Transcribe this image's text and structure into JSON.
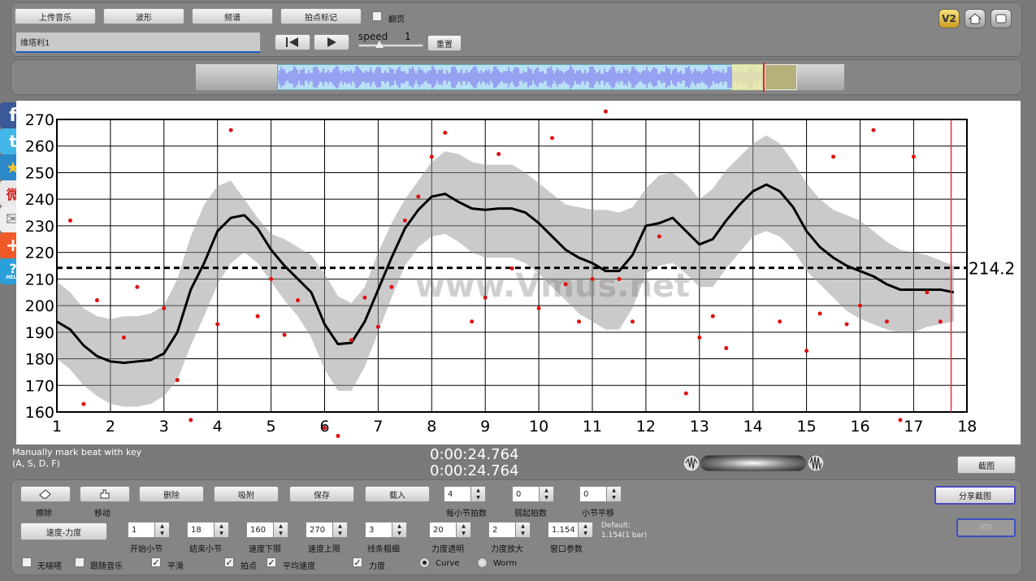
{
  "toolbar": {
    "upload_label": "上传音乐",
    "waveform_label": "波形",
    "spectrum_label": "频谱",
    "mark_beat_label": "拍点标记",
    "flip_label": "翻页",
    "track_title": "维塔利1",
    "speed_label": "speed",
    "speed_value": "1",
    "reset_label": "重置",
    "v2_label": "V2"
  },
  "social": [
    "f",
    "t",
    "★",
    "微",
    "✉",
    "+",
    "?"
  ],
  "social_help_text": "HELP",
  "chart_data": {
    "type": "line",
    "title": "",
    "xlabel": "",
    "ylabel": "",
    "xlim": [
      1,
      18
    ],
    "ylim": [
      160,
      270
    ],
    "xticks": [
      "1",
      "2",
      "3",
      "4",
      "5",
      "6",
      "7",
      "8",
      "9",
      "10",
      "11",
      "12",
      "13",
      "14",
      "15",
      "16",
      "17",
      "18"
    ],
    "yticks": [
      "160",
      "170",
      "180",
      "190",
      "200",
      "210",
      "220",
      "230",
      "240",
      "250",
      "260",
      "270"
    ],
    "average": 214.2,
    "average_label": "214.2",
    "end_marker_x": 17.7,
    "watermark": "www.Vmus.net",
    "smooth_curve": {
      "x": [
        1,
        1.25,
        1.5,
        1.75,
        2,
        2.25,
        2.5,
        2.75,
        3,
        3.25,
        3.5,
        3.75,
        4,
        4.25,
        4.5,
        4.75,
        5,
        5.25,
        5.5,
        5.75,
        6,
        6.25,
        6.5,
        6.75,
        7,
        7.25,
        7.5,
        7.75,
        8,
        8.25,
        8.5,
        8.75,
        9,
        9.25,
        9.5,
        9.75,
        10,
        10.25,
        10.5,
        10.75,
        11,
        11.25,
        11.5,
        11.75,
        12,
        12.25,
        12.5,
        12.75,
        13,
        13.25,
        13.5,
        13.75,
        14,
        14.25,
        14.5,
        14.75,
        15,
        15.25,
        15.5,
        15.75,
        16,
        16.25,
        16.5,
        16.75,
        17,
        17.25,
        17.5,
        17.75
      ],
      "y": [
        194,
        191,
        185,
        181,
        179,
        178.5,
        179,
        179.5,
        182,
        190,
        206,
        216,
        228,
        233,
        234,
        229,
        221,
        215,
        210,
        205,
        193,
        185.5,
        186,
        194,
        206,
        218,
        229,
        236,
        241,
        242,
        239,
        236.5,
        236,
        236.5,
        236.5,
        235,
        231,
        226,
        221,
        218,
        216,
        213,
        213,
        219,
        230,
        231,
        233,
        228,
        223,
        225,
        232,
        238,
        243,
        245.5,
        243,
        237,
        228,
        222,
        218,
        215,
        213,
        211,
        208,
        206,
        206,
        206,
        206,
        205
      ]
    },
    "band_upper": [
      209,
      205,
      199,
      196,
      195,
      196,
      196,
      197,
      200,
      210,
      226,
      238,
      245,
      247,
      240,
      233,
      227,
      225,
      222,
      219,
      212,
      203.5,
      201,
      207,
      220,
      231,
      240,
      247,
      254,
      258,
      257,
      254,
      253,
      253,
      253,
      250,
      246,
      242,
      238,
      237,
      236,
      236,
      235,
      237,
      244,
      249,
      250,
      246,
      240,
      244,
      251,
      256,
      261,
      264,
      261,
      254,
      246,
      240,
      236,
      234,
      232,
      228,
      224,
      221,
      220,
      219,
      217,
      215
    ],
    "band_lower": [
      180,
      176,
      170,
      166,
      163,
      162,
      162,
      163,
      166,
      172,
      185,
      196,
      208,
      216,
      220,
      216,
      209,
      202,
      196,
      188,
      176,
      168,
      168,
      177,
      190,
      203,
      215,
      222,
      226,
      227,
      224,
      220,
      218,
      218,
      218,
      216,
      212,
      207,
      202,
      197,
      194,
      191,
      191,
      199,
      212,
      215,
      216,
      212,
      207,
      207,
      214,
      220,
      226,
      228,
      226,
      221,
      213,
      208,
      203,
      198,
      195,
      193,
      191,
      190,
      190,
      192,
      193,
      194
    ],
    "scatter": {
      "x": [
        1.25,
        1.5,
        1.75,
        2.25,
        2.5,
        3,
        3.25,
        3.5,
        4,
        4.25,
        4.75,
        5,
        5.25,
        5.5,
        6,
        6.25,
        6.5,
        6.75,
        7,
        7.25,
        7.5,
        7.75,
        8,
        8.25,
        8.75,
        9,
        9.25,
        9.5,
        10,
        10.25,
        10.5,
        10.75,
        11,
        11.25,
        11.5,
        11.75,
        12.25,
        12.75,
        13,
        13.25,
        13.5,
        14.5,
        15,
        15.25,
        15.5,
        15.75,
        16,
        16.25,
        16.5,
        16.75,
        17,
        17.25,
        17.5
      ],
      "y": [
        232,
        163,
        202,
        188,
        207,
        199,
        172,
        157,
        193,
        266,
        196,
        210,
        189,
        202,
        154,
        151,
        187,
        203,
        192,
        207,
        232,
        241,
        256,
        265,
        194,
        203,
        257,
        214,
        199,
        263,
        208,
        194,
        210,
        273,
        210,
        194,
        226,
        167,
        188,
        196,
        184,
        194,
        183,
        197,
        256,
        193,
        200,
        266,
        194,
        157,
        256,
        205,
        194
      ]
    }
  },
  "playback": {
    "status_line1": "Manually mark beat with key",
    "status_line2": "(A, S, D, F)",
    "time_current": "0:00:24.764",
    "time_total": "0:00:24.764",
    "screenshot_label": "截图"
  },
  "controls": {
    "row1_buttons": [
      "",
      "",
      "删除",
      "吸附",
      "保存",
      "载入"
    ],
    "erase_label": "擦除",
    "move_label": "移动",
    "share_label": "分享截图",
    "ioi_label": "IOI",
    "speed_dyn_label": "速度-力度",
    "beats_per_bar_value": "4",
    "beats_per_bar_label": "每小节拍数",
    "pickup_value": "0",
    "pickup_label": "弱起拍数",
    "bar_shift_value": "0",
    "bar_shift_label": "小节平移",
    "start_bar_value": "1",
    "start_bar_label": "开始小节",
    "end_bar_value": "18",
    "end_bar_label": "结束小节",
    "tempo_min_value": "160",
    "tempo_min_label": "速度下限",
    "tempo_max_value": "270",
    "tempo_max_label": "速度上限",
    "line_width_value": "3",
    "line_width_label": "线条粗细",
    "dyn_opacity_value": "20",
    "dyn_opacity_label": "力度透明",
    "dyn_scale_value": "2",
    "dyn_scale_label": "力度放大",
    "window_value": "1.154",
    "window_label": "窗口参数",
    "default_line1": "Default:",
    "default_line2": "1.154(1 bar)",
    "cb_mute_label": "无喘嗒",
    "cb_follow_label": "跟随音乐",
    "cb_smooth_label": "平滑",
    "cb_beats_label": "拍点",
    "cb_avg_label": "平均速度",
    "cb_dyn_label": "力度",
    "radio_curve_label": "Curve",
    "radio_worm_label": "Worm",
    "check_mark": "✓"
  }
}
